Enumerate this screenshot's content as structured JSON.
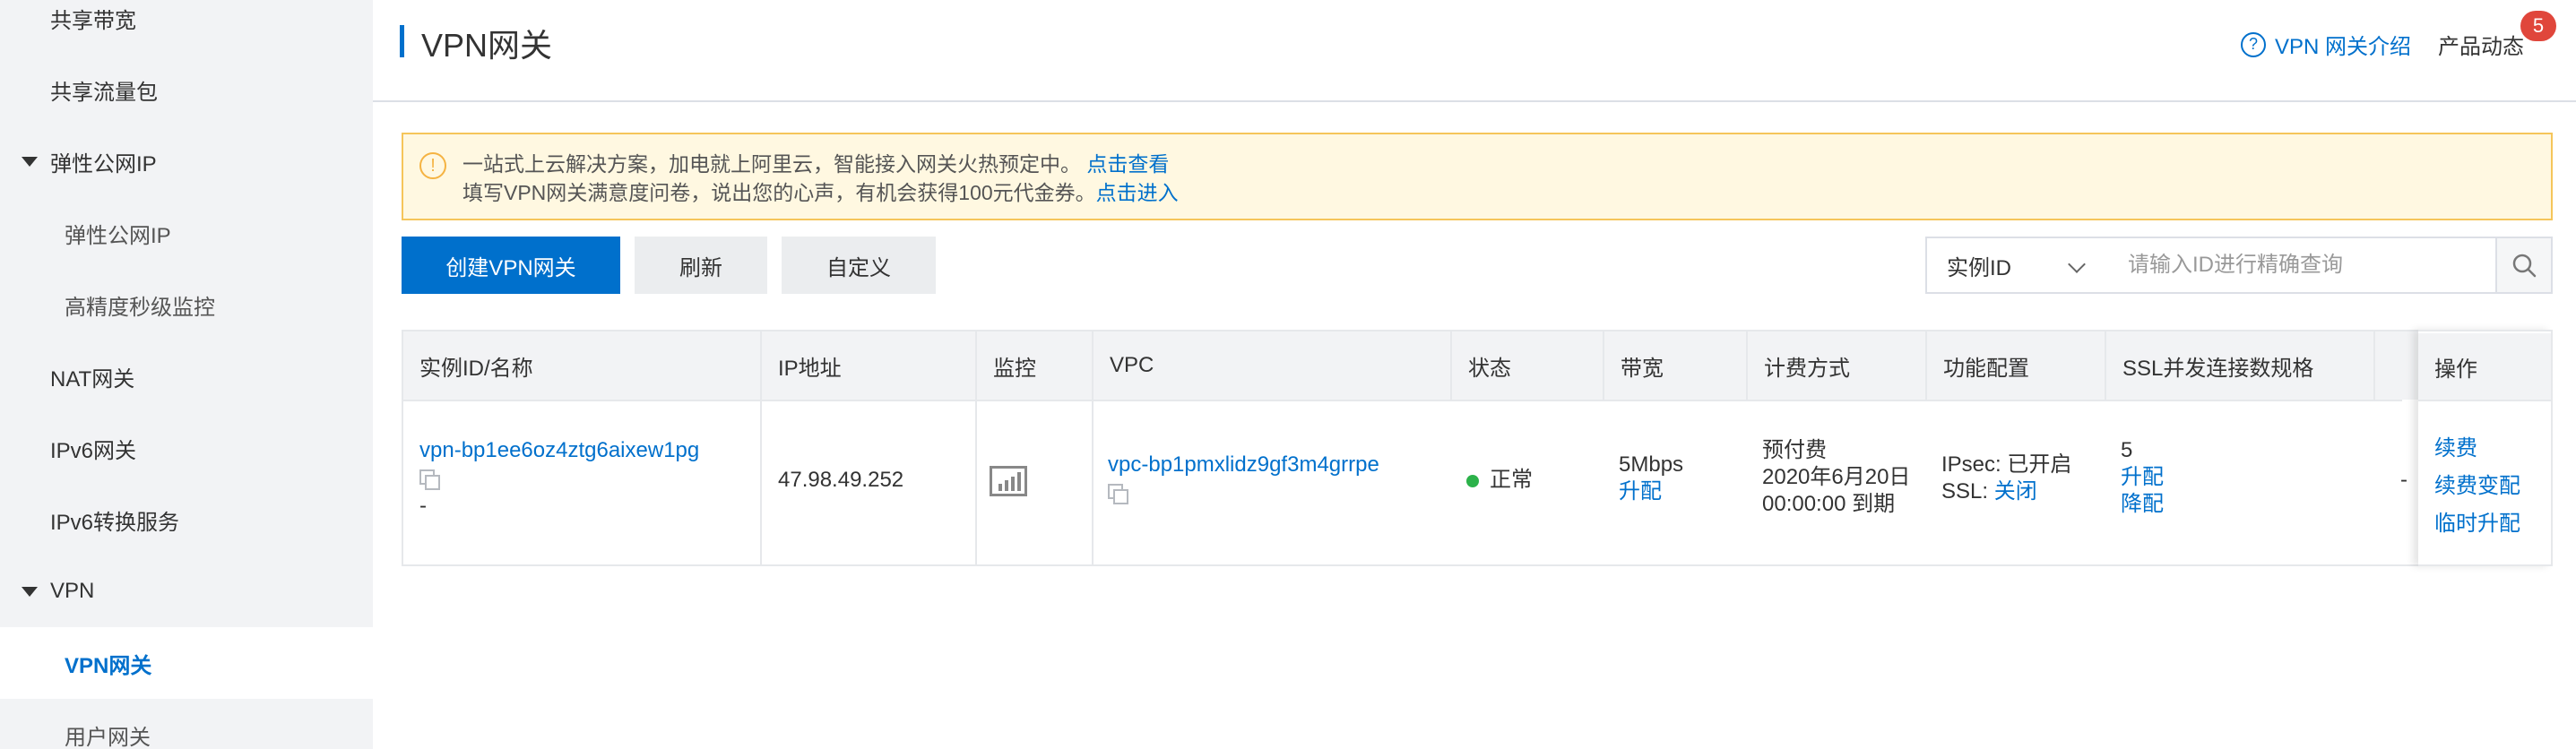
{
  "sidebar": {
    "items": [
      {
        "label": "共享带宽"
      },
      {
        "label": "共享流量包"
      },
      {
        "label": "弹性公网IP"
      },
      {
        "label": "弹性公网IP"
      },
      {
        "label": "高精度秒级监控"
      },
      {
        "label": "NAT网关"
      },
      {
        "label": "IPv6网关"
      },
      {
        "label": "IPv6转换服务"
      },
      {
        "label": "VPN"
      },
      {
        "label": "VPN网关"
      },
      {
        "label": "用户网关"
      }
    ]
  },
  "header": {
    "title": "VPN网关",
    "intro_link": "VPN 网关介绍",
    "news_label": "产品动态",
    "news_badge": "5"
  },
  "notice": {
    "line1": "一站式上云解决方案，加电就上阿里云，智能接入网关火热预定中。",
    "line1_link": "点击查看",
    "line2": "填写VPN网关满意度问卷，说出您的心声，有机会获得100元代金券。",
    "line2_link": "点击进入"
  },
  "toolbar": {
    "create_label": "创建VPN网关",
    "refresh_label": "刷新",
    "customize_label": "自定义",
    "filter_selected": "实例ID",
    "search_placeholder": "请输入ID进行精确查询"
  },
  "table": {
    "headers": [
      "实例ID/名称",
      "IP地址",
      "监控",
      "VPC",
      "状态",
      "带宽",
      "计费方式",
      "功能配置",
      "SSL并发连接数规格",
      "操作"
    ],
    "row": {
      "instance_id": "vpn-bp1ee6oz4ztg6aixew1pg",
      "name": "-",
      "ip": "47.98.49.252",
      "vpc": "vpc-bp1pmxlidz9gf3m4grrpe",
      "status": "正常",
      "bandwidth": "5Mbps",
      "bandwidth_action": "升配",
      "billing_type": "预付费",
      "billing_date": "2020年6月20日",
      "billing_expire": "00:00:00 到期",
      "ipsec_label": "IPsec:",
      "ipsec_value": "已开启",
      "ssl_label": "SSL:",
      "ssl_value": "关闭",
      "ssl_spec": "5",
      "ssl_upgrade": "升配",
      "ssl_downgrade": "降配",
      "ops": [
        "续费",
        "续费变配",
        "临时升配"
      ],
      "hidden_cell": "-"
    }
  },
  "colors": {
    "accent": "#0070cc",
    "status_ok": "#2cb24a",
    "badge": "#e0463b",
    "notice_bg": "#fff8e1"
  }
}
